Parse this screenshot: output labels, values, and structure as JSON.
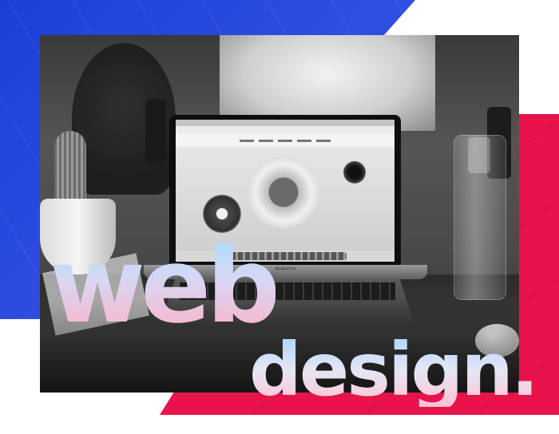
{
  "headline": {
    "line1": "web",
    "line2": "design."
  },
  "photo": {
    "laptop_brand": "MacBook Pro"
  },
  "colors": {
    "blue_shape": "#1f3ed4",
    "red_shape": "#e8134b",
    "text_gradient_top": "#aedcff",
    "text_gradient_bottom": "#ffb0c8"
  }
}
